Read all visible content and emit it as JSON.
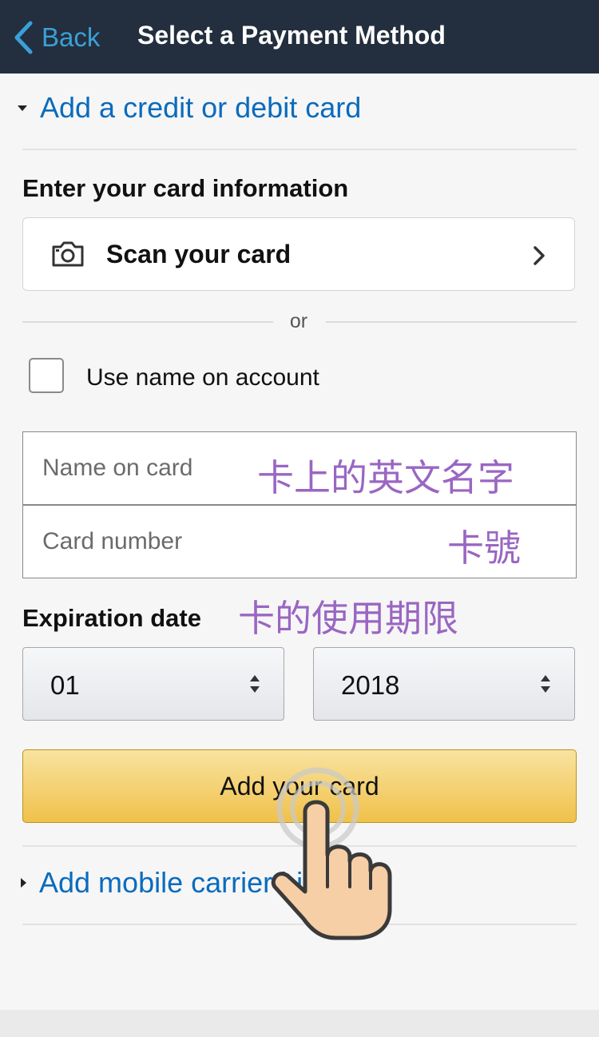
{
  "nav": {
    "back_label": "Back",
    "title": "Select a Payment Method"
  },
  "card_section": {
    "header": "Add a credit or debit card",
    "heading": "Enter your card information",
    "scan_label": "Scan your card",
    "or_text": "or",
    "use_name_label": "Use name on account",
    "use_name_checked": false,
    "name_placeholder": "Name on card",
    "number_placeholder": "Card number",
    "expiration_label": "Expiration date",
    "month_value": "01",
    "year_value": "2018",
    "add_button": "Add your card"
  },
  "annotations": {
    "name_hint": "卡上的英文名字",
    "number_hint": "卡號",
    "expiry_hint": "卡的使用期限"
  },
  "carrier_section": {
    "header": "Add mobile carrier billing"
  },
  "colors": {
    "navbar": "#232f3e",
    "link": "#0a6bbd",
    "back": "#3aa0d8",
    "button": "#f0c14b",
    "annotation": "#9a66c2"
  },
  "icons": [
    "chevron-left-icon",
    "caret-down-icon",
    "camera-icon",
    "chevron-right-icon",
    "select-arrows-icon",
    "caret-right-icon",
    "hand-pointer-icon"
  ]
}
